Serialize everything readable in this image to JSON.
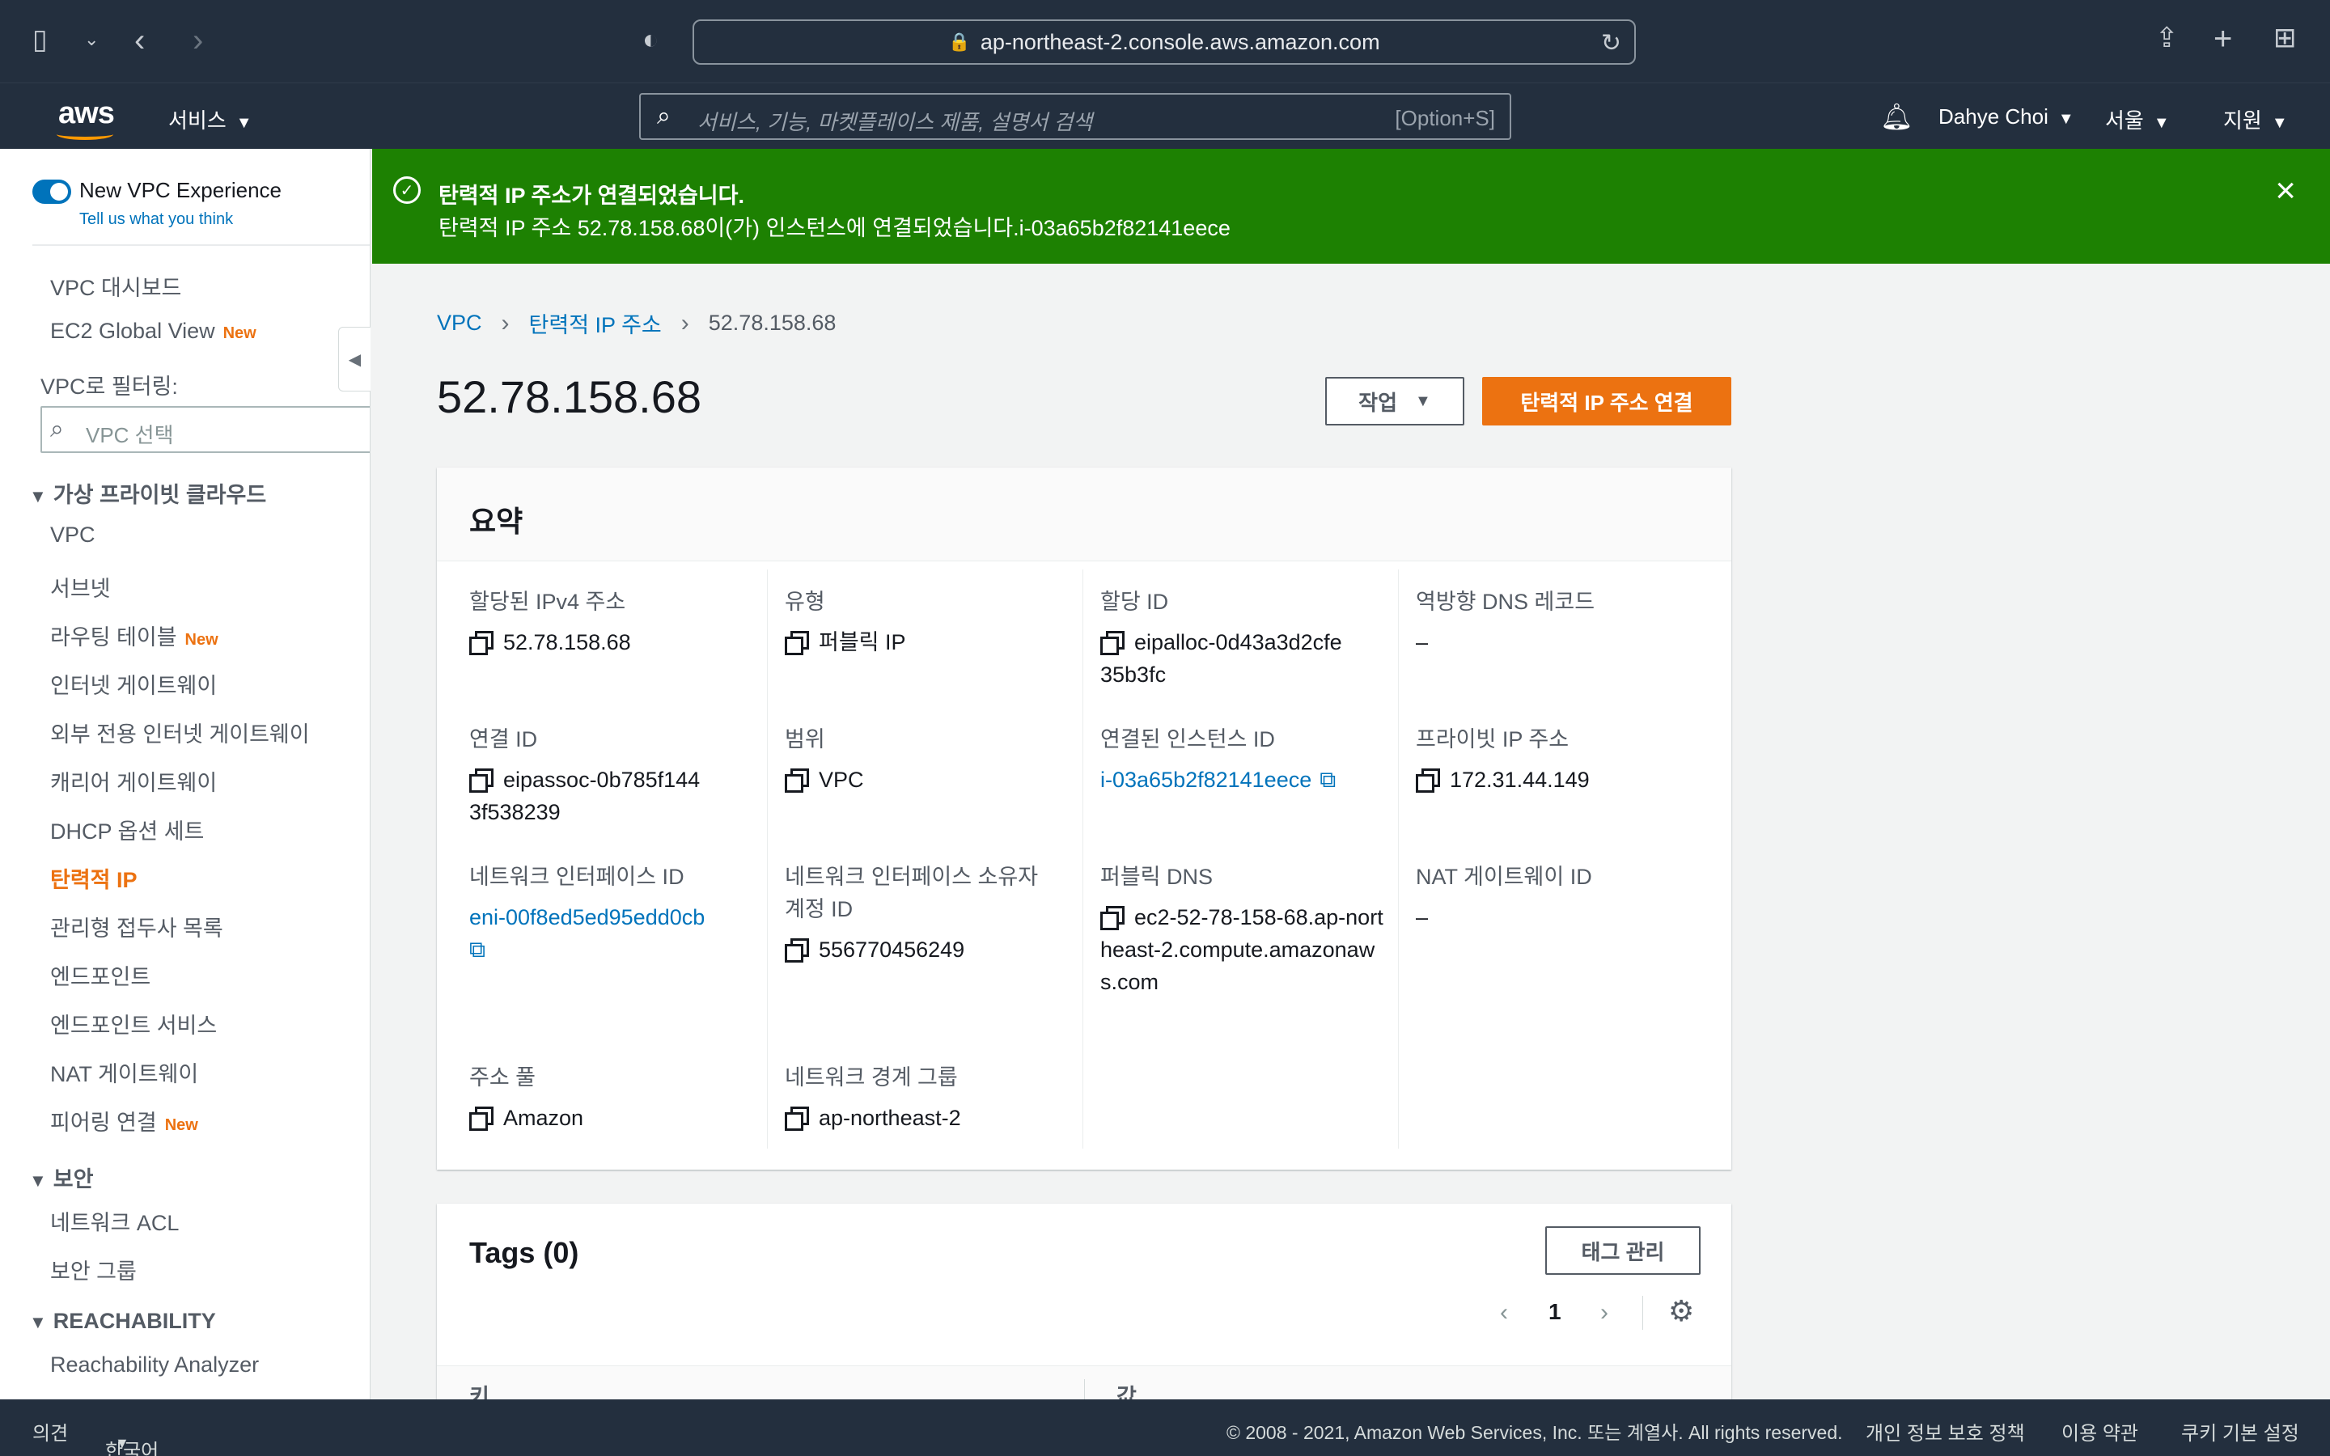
{
  "browser": {
    "url": "ap-northeast-2.console.aws.amazon.com",
    "icons": [
      "sidebar-icon",
      "chevron-down-icon",
      "back-icon",
      "forward-icon",
      "shield-icon",
      "share-icon",
      "new-tab-icon",
      "tab-overview-icon"
    ]
  },
  "header": {
    "logo": "aws",
    "services_label": "서비스",
    "search_placeholder": "서비스, 기능, 마켓플레이스 제품, 설명서 검색",
    "search_shortcut": "[Option+S]",
    "user": "Dahye Choi",
    "region": "서울",
    "support": "지원"
  },
  "sidebar": {
    "toggle_label": "New VPC Experience",
    "feedback": "Tell us what you think",
    "top_items": [
      {
        "label": "VPC 대시보드",
        "badge": ""
      },
      {
        "label": "EC2 Global View",
        "badge": "New"
      }
    ],
    "filter_label": "VPC로 필터링:",
    "filter_placeholder": "VPC 선택",
    "sections": [
      {
        "title": "가상 프라이빗 클라우드",
        "items": [
          {
            "label": "VPC",
            "badge": ""
          },
          {
            "label": "서브넷",
            "badge": ""
          },
          {
            "label": "라우팅 테이블",
            "badge": "New"
          },
          {
            "label": "인터넷 게이트웨이",
            "badge": ""
          },
          {
            "label": "외부 전용 인터넷 게이트웨이",
            "badge": ""
          },
          {
            "label": "캐리어 게이트웨이",
            "badge": ""
          },
          {
            "label": "DHCP 옵션 세트",
            "badge": ""
          },
          {
            "label": "탄력적 IP",
            "badge": ""
          },
          {
            "label": "관리형 접두사 목록",
            "badge": ""
          },
          {
            "label": "엔드포인트",
            "badge": ""
          },
          {
            "label": "엔드포인트 서비스",
            "badge": ""
          },
          {
            "label": "NAT 게이트웨이",
            "badge": ""
          },
          {
            "label": "피어링 연결",
            "badge": "New"
          }
        ]
      },
      {
        "title": "보안",
        "items": [
          {
            "label": "네트워크 ACL",
            "badge": ""
          },
          {
            "label": "보안 그룹",
            "badge": ""
          }
        ]
      },
      {
        "title": "REACHABILITY",
        "items": [
          {
            "label": "Reachability Analyzer",
            "badge": ""
          }
        ]
      }
    ]
  },
  "flash": {
    "title": "탄력적 IP 주소가 연결되었습니다.",
    "message": "탄력적 IP 주소 52.78.158.68이(가) 인스턴스에 연결되었습니다.i-03a65b2f82141eece"
  },
  "breadcrumb": [
    "VPC",
    "탄력적 IP 주소",
    "52.78.158.68"
  ],
  "page_title": "52.78.158.68",
  "actions": {
    "action_label": "작업",
    "primary_label": "탄력적 IP 주소 연결"
  },
  "summary": {
    "title": "요약",
    "fields": [
      {
        "key": "할당된 IPv4 주소",
        "value": "52.78.158.68",
        "copy": true,
        "link": false
      },
      {
        "key": "유형",
        "value": "퍼블릭 IP",
        "copy": true,
        "link": false
      },
      {
        "key": "할당 ID",
        "value": "eipalloc-0d43a3d2cfe35b3fc",
        "copy": true,
        "link": false
      },
      {
        "key": "역방향 DNS 레코드",
        "value": "–",
        "copy": false,
        "link": false
      },
      {
        "key": "연결 ID",
        "value": "eipassoc-0b785f1443f538239",
        "copy": true,
        "link": false
      },
      {
        "key": "범위",
        "value": "VPC",
        "copy": true,
        "link": false
      },
      {
        "key": "연결된 인스턴스 ID",
        "value": "i-03a65b2f82141eece",
        "copy": false,
        "link": true
      },
      {
        "key": "프라이빗 IP 주소",
        "value": "172.31.44.149",
        "copy": true,
        "link": false
      },
      {
        "key": "네트워크 인터페이스 ID",
        "value": "eni-00f8ed5ed95edd0cb",
        "copy": false,
        "link": true
      },
      {
        "key": "네트워크 인터페이스 소유자 계정 ID",
        "value": "556770456249",
        "copy": true,
        "link": false
      },
      {
        "key": "퍼블릭 DNS",
        "value": "ec2-52-78-158-68.ap-northeast-2.compute.amazonaws.com",
        "copy": true,
        "link": false
      },
      {
        "key": "NAT 게이트웨이 ID",
        "value": "–",
        "copy": false,
        "link": false
      },
      {
        "key": "주소 풀",
        "value": "Amazon",
        "copy": true,
        "link": false
      },
      {
        "key": "네트워크 경계 그룹",
        "value": "ap-northeast-2",
        "copy": true,
        "link": false
      }
    ]
  },
  "tags": {
    "title": "Tags (0)",
    "manage_label": "태그 관리",
    "page": "1",
    "columns": [
      "키",
      "값"
    ]
  },
  "footer": {
    "feedback": "의견",
    "language": "한국어",
    "copyright": "© 2008 - 2021, Amazon Web Services, Inc. 또는 계열사. All rights reserved.",
    "privacy": "개인 정보 보호 정책",
    "terms": "이용 약관",
    "cookies": "쿠키 기본 설정"
  },
  "colors": {
    "header_bg": "#232f3e",
    "accent_orange": "#ec7211",
    "success_green": "#1d8102",
    "link_blue": "#0073bb"
  }
}
